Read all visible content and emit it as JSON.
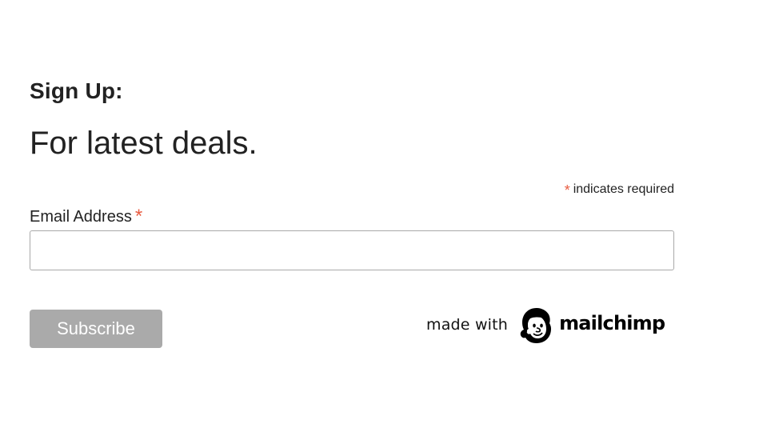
{
  "form": {
    "heading": "Sign Up:",
    "subheading": "For latest deals.",
    "required_asterisk": "*",
    "required_note": "indicates required",
    "email_label": "Email Address",
    "email_value": "",
    "email_placeholder": "",
    "subscribe_label": "Subscribe"
  },
  "badge": {
    "made_with": "made with",
    "logo_text": "mailchimp",
    "logo_icon": "mailchimp-freddie-icon"
  },
  "colors": {
    "asterisk": "#e85c41",
    "button_bg": "#aaaaaa",
    "button_text": "#ffffff",
    "input_border": "#a9a9a9",
    "text": "#222222"
  }
}
